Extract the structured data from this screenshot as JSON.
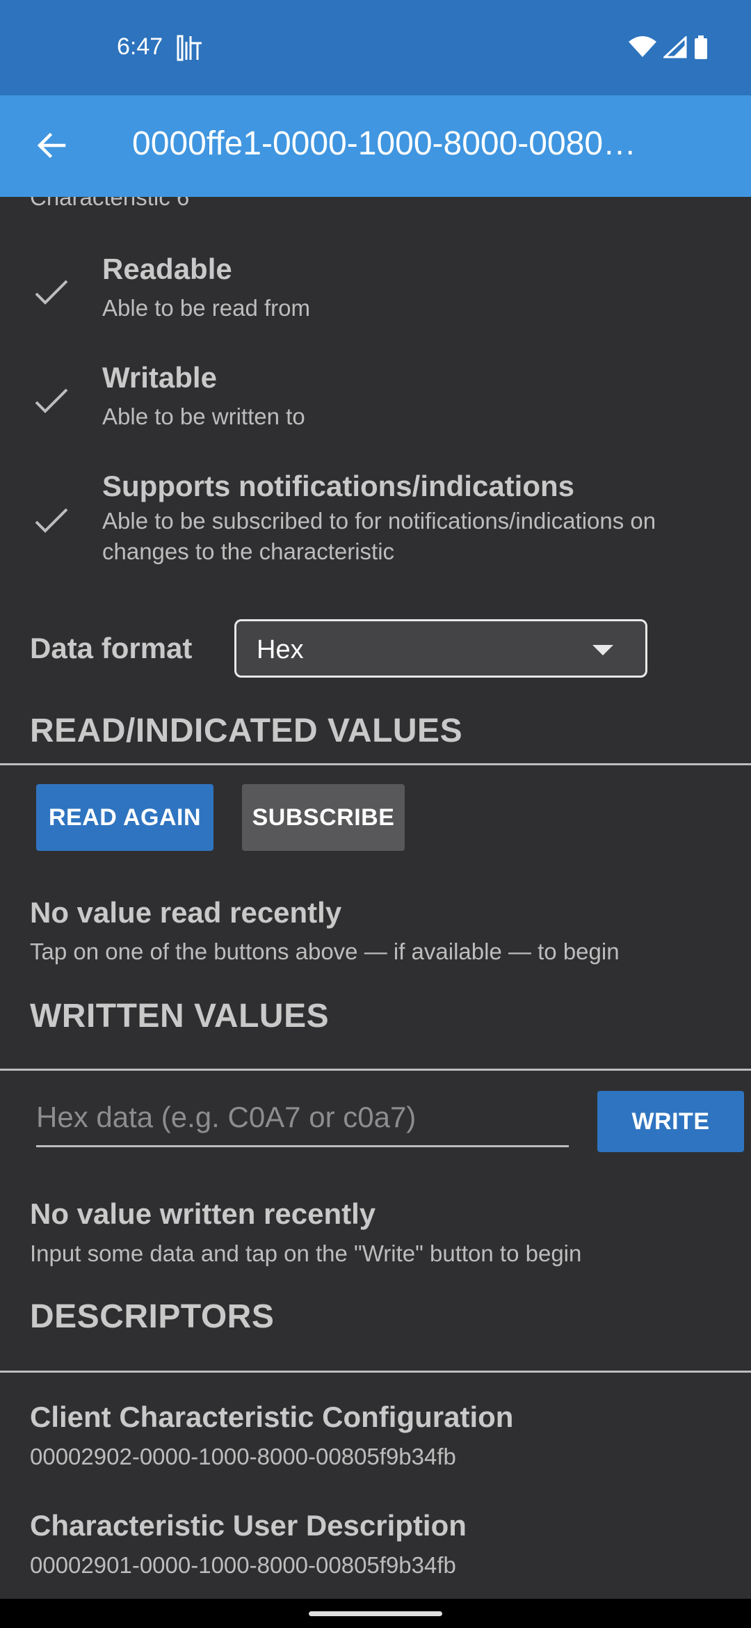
{
  "status_bar": {
    "time": "6:47",
    "background": "#2d73bd"
  },
  "app_bar": {
    "title": "0000ffe1-0000-1000-8000-0080…",
    "back_icon": "arrow-back-icon",
    "background": "#4096e0"
  },
  "characteristic": {
    "subtitle": "Characteristic 6"
  },
  "properties": [
    {
      "title": "Readable",
      "description": "Able to be read from",
      "icon": "check-icon"
    },
    {
      "title": "Writable",
      "description": "Able to be written to",
      "icon": "check-icon"
    },
    {
      "title": "Supports notifications/indications",
      "description": "Able to be subscribed to for notifications/indications on changes to the characteristic",
      "icon": "check-icon"
    }
  ],
  "data_format": {
    "label": "Data format",
    "selected": "Hex"
  },
  "read_section": {
    "header": "READ/INDICATED VALUES",
    "read_again_label": "READ AGAIN",
    "subscribe_label": "SUBSCRIBE",
    "empty_title": "No value read recently",
    "empty_desc": "Tap on one of the buttons above — if available — to begin"
  },
  "written_section": {
    "header": "WRITTEN VALUES",
    "input_placeholder": "Hex data (e.g. C0A7 or c0a7)",
    "input_value": "",
    "write_label": "WRITE",
    "empty_title": "No value written recently",
    "empty_desc": "Input some data and tap on the \"Write\" button to begin"
  },
  "descriptors_section": {
    "header": "DESCRIPTORS",
    "items": [
      {
        "name": "Client Characteristic Configuration",
        "uuid": "00002902-0000-1000-8000-00805f9b34fb"
      },
      {
        "name": "Characteristic User Description",
        "uuid": "00002901-0000-1000-8000-00805f9b34fb"
      }
    ]
  },
  "colors": {
    "accent": "#2f74c0",
    "background": "#2f2f31",
    "secondary_button": "#58585a"
  }
}
